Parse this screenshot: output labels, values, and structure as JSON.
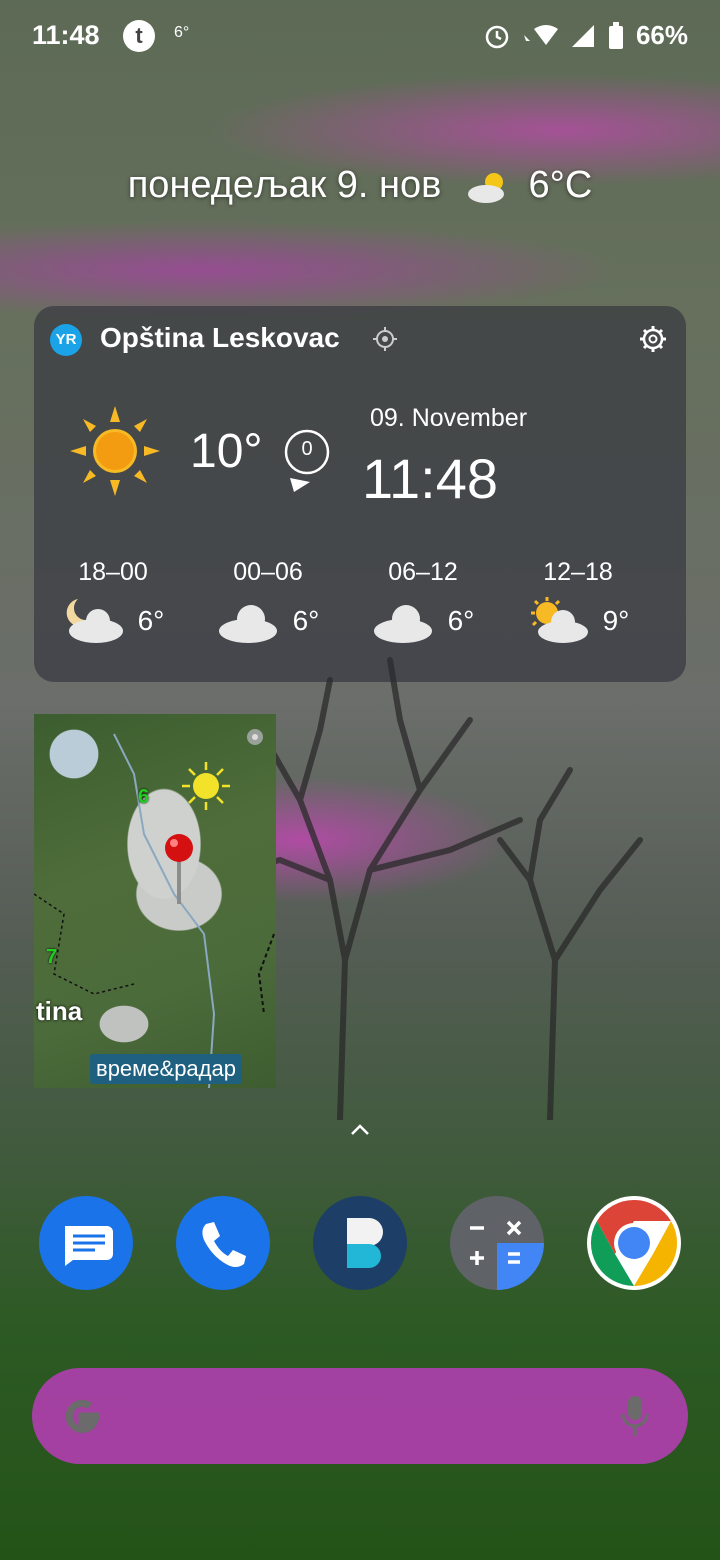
{
  "status_bar": {
    "time": "11:48",
    "notification_badge": "t",
    "notification_temp": "6°",
    "battery": "66%",
    "icons": [
      "alarm-icon",
      "wifi-icon",
      "signal-icon",
      "battery-icon"
    ]
  },
  "date_line": {
    "date": "понедељак 9. нов",
    "temp": "6°C",
    "icon": "partly-cloudy-icon"
  },
  "weather_widget": {
    "logo": "YR",
    "location": "Opština Leskovac",
    "current_temp": "10°",
    "wind": "0",
    "date": "09. November",
    "time": "11:48",
    "forecast": [
      {
        "period": "18–00",
        "temp": "6°",
        "icon": "moon-cloud-icon"
      },
      {
        "period": "00–06",
        "temp": "6°",
        "icon": "cloud-icon"
      },
      {
        "period": "06–12",
        "temp": "6°",
        "icon": "cloud-icon"
      },
      {
        "period": "12–18",
        "temp": "9°",
        "icon": "sun-cloud-icon"
      }
    ]
  },
  "radar_widget": {
    "label_6": "6",
    "label_7": "7",
    "place": "tina",
    "brand": "време&радар"
  },
  "dock": {
    "apps": [
      "messages-icon",
      "phone-icon",
      "app-icon",
      "calculator-icon",
      "chrome-icon"
    ]
  },
  "colors": {
    "search_bar": "#be3cbe",
    "yr_blue": "#1ba3e8",
    "phone_blue": "#1a73e8"
  }
}
